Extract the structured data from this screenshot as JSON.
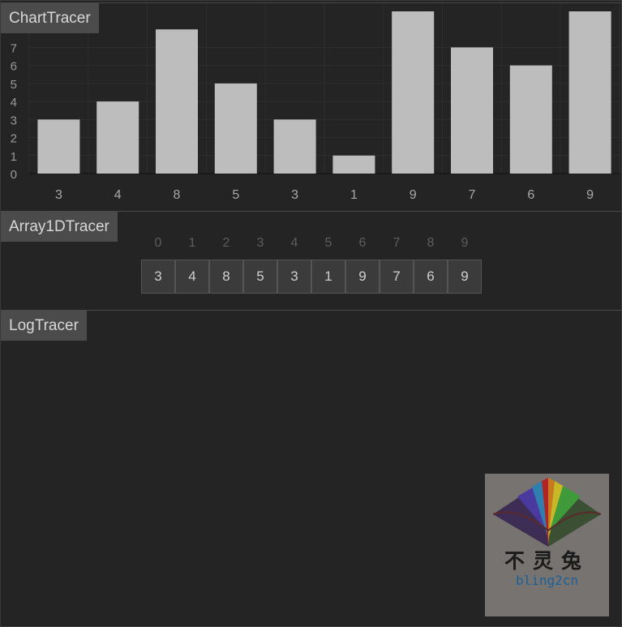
{
  "chart_panel": {
    "title": "ChartTracer"
  },
  "chart_data": {
    "type": "bar",
    "categories": [
      "3",
      "4",
      "8",
      "5",
      "3",
      "1",
      "9",
      "7",
      "6",
      "9"
    ],
    "values": [
      3,
      4,
      8,
      5,
      3,
      1,
      9,
      7,
      6,
      9
    ],
    "title": "",
    "xlabel": "",
    "ylabel": "",
    "ylim": [
      0,
      9
    ],
    "yticks": [
      0,
      1,
      2,
      3,
      4,
      5,
      6,
      7
    ],
    "grid": true,
    "bar_color": "#bdbdbd"
  },
  "array_panel": {
    "title": "Array1DTracer",
    "indices": [
      "0",
      "1",
      "2",
      "3",
      "4",
      "5",
      "6",
      "7",
      "8",
      "9"
    ],
    "values": [
      "3",
      "4",
      "8",
      "5",
      "3",
      "1",
      "9",
      "7",
      "6",
      "9"
    ]
  },
  "log_panel": {
    "title": "LogTracer",
    "lines": []
  },
  "watermark": {
    "cjk": "不灵兔",
    "latin": "bling2cn"
  }
}
